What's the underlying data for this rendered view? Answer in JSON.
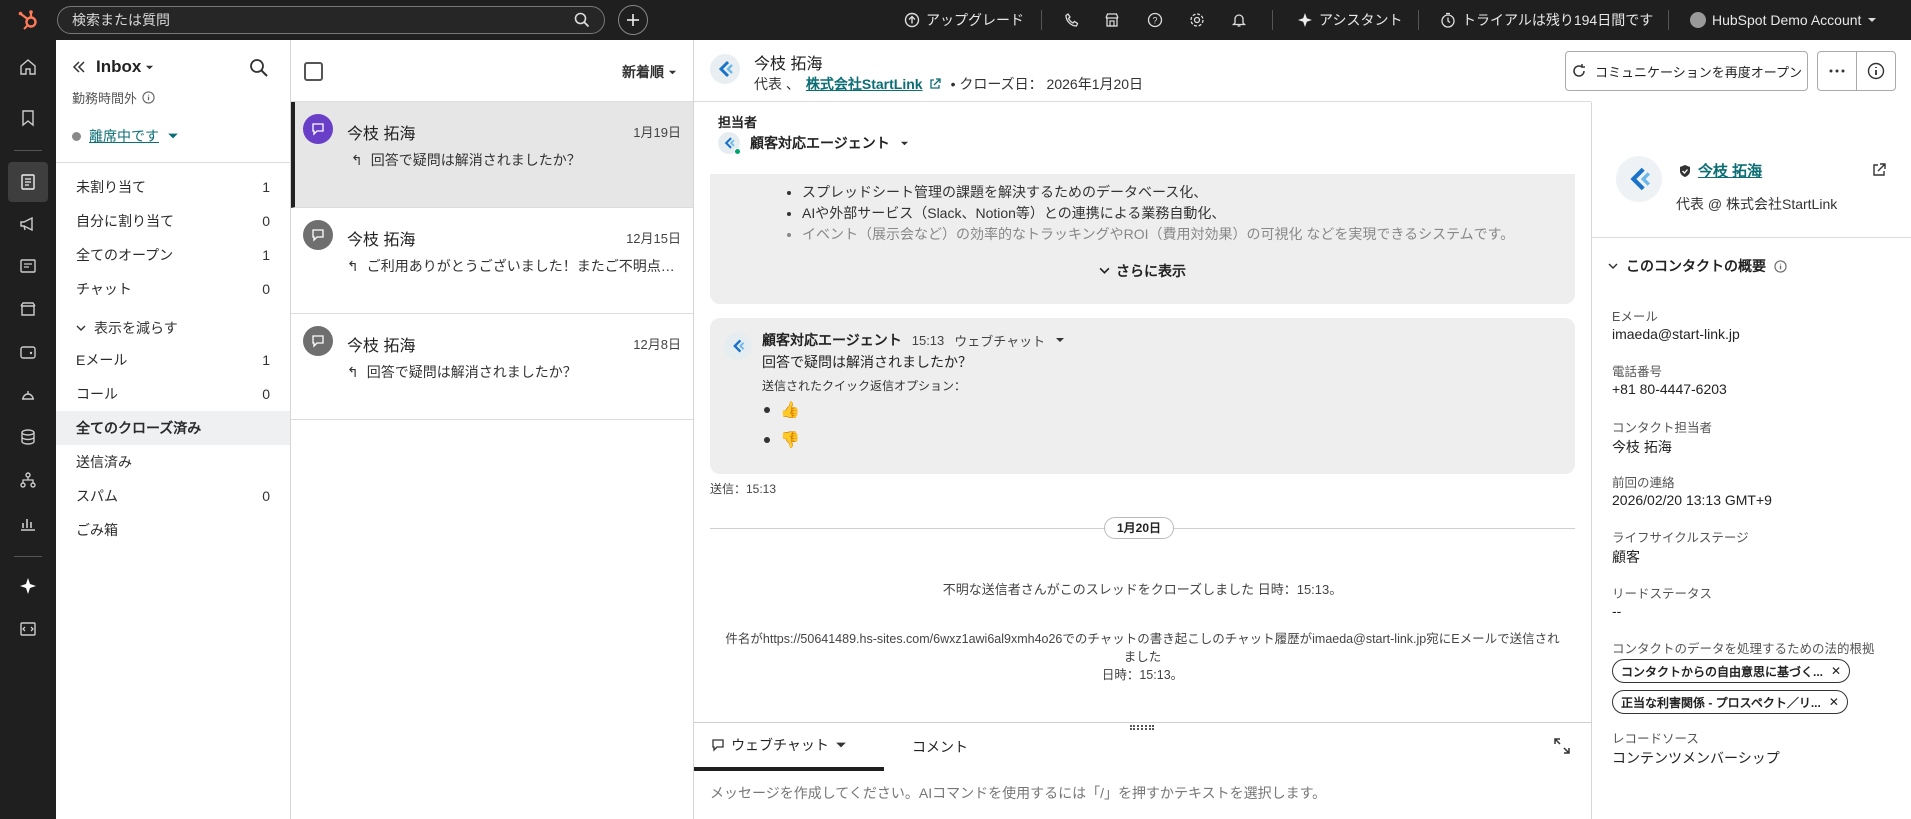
{
  "topbar": {
    "search_placeholder": "検索または質問",
    "upgrade": "アップグレード",
    "assistant": "アシスタント",
    "trial": "トライアルは残り194日間です",
    "account": "HubSpot Demo Account"
  },
  "sidebar": {
    "title": "Inbox",
    "hours": "勤務時間外",
    "status": "離席中です",
    "items": [
      {
        "label": "未割り当て",
        "count": "1"
      },
      {
        "label": "自分に割り当て",
        "count": "0"
      },
      {
        "label": "全てのオープン",
        "count": "1"
      },
      {
        "label": "チャット",
        "count": "0"
      },
      {
        "label": "Eメール",
        "count": "1"
      },
      {
        "label": "コール",
        "count": "0"
      },
      {
        "label": "全てのクローズ済み",
        "count": ""
      },
      {
        "label": "送信済み",
        "count": ""
      },
      {
        "label": "スパム",
        "count": "0"
      },
      {
        "label": "ごみ箱",
        "count": ""
      }
    ],
    "toggle": "表示を減らす"
  },
  "conversations": {
    "sort": "新着順",
    "items": [
      {
        "name": "今枝 拓海",
        "date": "1月19日",
        "preview": "回答で疑問は解消されましたか？"
      },
      {
        "name": "今枝 拓海",
        "date": "12月15日",
        "preview": "ご利用ありがとうございました！またご不明点がございましたら"
      },
      {
        "name": "今枝 拓海",
        "date": "12月8日",
        "preview": "回答で疑問は解消されましたか？"
      }
    ]
  },
  "header": {
    "name": "今枝 拓海",
    "role": "代表 、",
    "company": "株式会社StartLink",
    "closed": "• クローズ日： 2026年1月20日",
    "reopen": "コミュニケーションを再度オープン"
  },
  "assignee": {
    "label": "担当者",
    "agent": "顧客対応エージェント"
  },
  "thread": {
    "bullets": [
      "スプレッドシート管理の課題を解決するためのデータベース化、",
      "AIや外部サービス（Slack、Notion等）との連携による業務自動化、",
      "イベント（展示会など）の効率的なトラッキングやROI（費用対効果）の可視化 などを実現できるシステムです。"
    ],
    "show_more": "さらに表示",
    "agent_name": "顧客対応エージェント",
    "time": "15:13",
    "channel": "ウェブチャット",
    "message": "回答で疑問は解消されましたか？",
    "quick_reply_label": "送信されたクイック返信オプション：",
    "options": [
      "👍",
      "👎"
    ],
    "sent": "送信：15:13",
    "date_divider": "1月20日",
    "system1": "不明な送信者さんがこのスレッドをクローズしました 日時：15:13。",
    "system2": "件名がhttps://50641489.hs-sites.com/6wxz1awi6al9xmh4o26でのチャットの書き起こしのチャット履歴がimaeda@start-link.jp宛にEメールで送信されました",
    "system3": "日時：15:13。"
  },
  "composer": {
    "tab1": "ウェブチャット",
    "tab2": "コメント",
    "placeholder": "メッセージを作成してください。AIコマンドを使用するには「/」を押すかテキストを選択します。"
  },
  "contact": {
    "name": "今枝 拓海",
    "role": "代表 @ 株式会社StartLink",
    "section": "このコンタクトの概要",
    "fields": [
      {
        "label": "Eメール",
        "value": "imaeda@start-link.jp"
      },
      {
        "label": "電話番号",
        "value": "+81 80-4447-6203"
      },
      {
        "label": "コンタクト担当者",
        "value": "今枝 拓海"
      },
      {
        "label": "前回の連絡",
        "value": "2026/02/20 13:13 GMT+9"
      },
      {
        "label": "ライフサイクルステージ",
        "value": "顧客"
      },
      {
        "label": "リードステータス",
        "value": "--"
      }
    ],
    "legal_label": "コンタクトのデータを処理するための法的根拠",
    "chips": [
      "コンタクトからの自由意思に基づく...",
      "正当な利害関係 - プロスペクト／リ..."
    ],
    "source_label": "レコードソース",
    "source_value": "コンテンツメンバーシップ"
  },
  "colors": {
    "accent": "#0b6e74",
    "dark": "#1f1f1f",
    "avatar_active": "#6a3fc8",
    "avatar": "#6f6f6f"
  }
}
